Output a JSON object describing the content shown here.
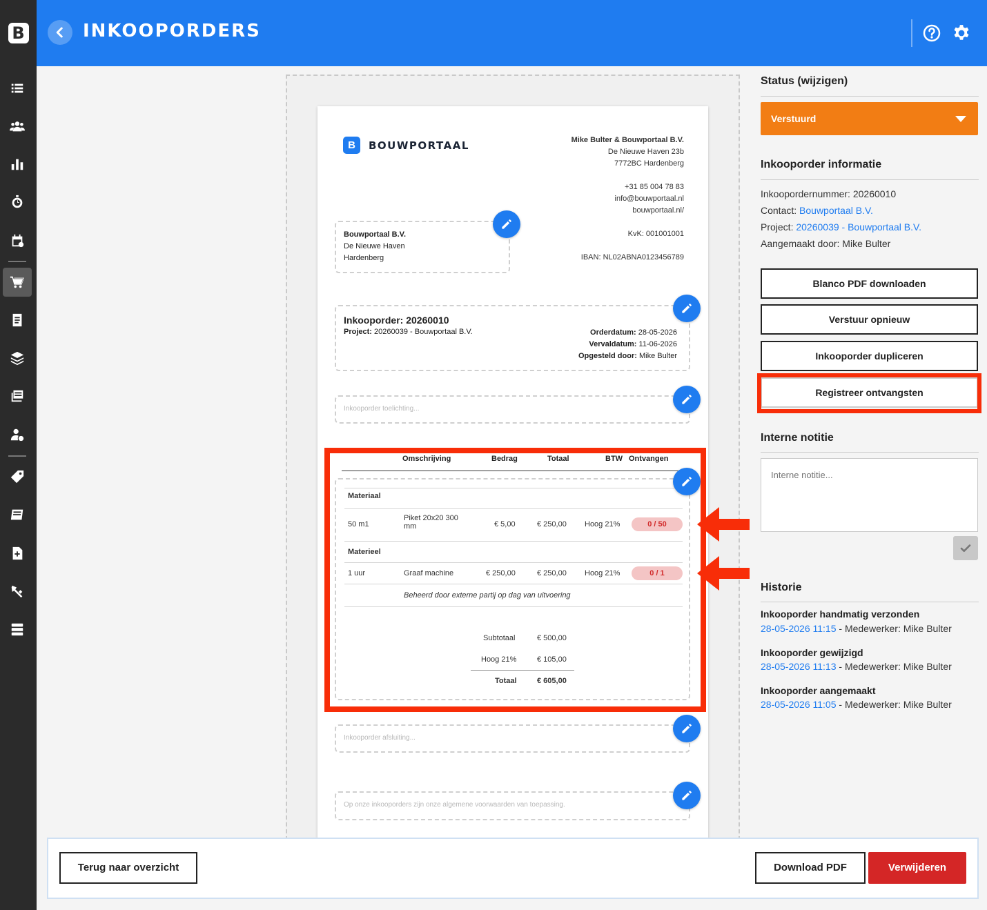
{
  "app": {
    "logo_letter": "B",
    "title": "INKOOPORDERS"
  },
  "sidebar": {
    "items": [
      {
        "icon": "list-icon"
      },
      {
        "icon": "users-icon"
      },
      {
        "icon": "chart-icon"
      },
      {
        "icon": "stopwatch-icon"
      },
      {
        "icon": "calendar-icon"
      },
      {
        "icon": "cart-icon",
        "active": true
      },
      {
        "icon": "document-icon"
      },
      {
        "icon": "layers-icon"
      },
      {
        "icon": "stack-icon"
      },
      {
        "icon": "user-settings-icon"
      },
      {
        "icon": "tag-icon"
      },
      {
        "icon": "book-icon"
      },
      {
        "icon": "file-plus-icon"
      },
      {
        "icon": "tools-icon"
      },
      {
        "icon": "server-icon"
      }
    ]
  },
  "document": {
    "brand_letter": "B",
    "brand_name": "BOUWPORTAAL",
    "company": {
      "name": "Mike Bulter & Bouwportaal B.V.",
      "street": "De Nieuwe Haven 23b",
      "city": "7772BC Hardenberg",
      "phone": "+31 85 004 78 83",
      "email": "info@bouwportaal.nl",
      "website": "bouwportaal.nl/",
      "kvk": "KvK: 001001001",
      "iban": "IBAN: NL02ABNA0123456789"
    },
    "recipient": {
      "name": "Bouwportaal B.V.",
      "street": "De Nieuwe Haven",
      "city": "Hardenberg"
    },
    "order": {
      "title": "Inkooporder: 20260010",
      "project_label": "Project:",
      "project_value": "20260039 - Bouwportaal B.V.",
      "orderdatum_label": "Orderdatum:",
      "orderdatum_value": "28-05-2026",
      "vervaldatum_label": "Vervaldatum:",
      "vervaldatum_value": "11-06-2026",
      "opgesteld_label": "Opgesteld door:",
      "opgesteld_value": "Mike Bulter"
    },
    "toelichting_placeholder": "Inkooporder toelichting...",
    "table_headers": {
      "omschrijving": "Omschrijving",
      "bedrag": "Bedrag",
      "totaal": "Totaal",
      "btw": "BTW",
      "ontvangen": "Ontvangen"
    },
    "groups": [
      {
        "name": "Materiaal",
        "row": {
          "qty": "50 m1",
          "desc_line1": "Piket 20x20 300",
          "desc_line2": "mm",
          "bedrag": "€ 5,00",
          "totaal": "€ 250,00",
          "btw": "Hoog 21%",
          "ontvangen": "0 / 50"
        }
      },
      {
        "name": "Materieel",
        "row": {
          "qty": "1 uur",
          "desc": "Graaf machine",
          "bedrag": "€ 250,00",
          "totaal": "€ 250,00",
          "btw": "Hoog 21%",
          "ontvangen": "0 / 1"
        },
        "note": "Beheerd door externe partij op dag van uitvoering"
      }
    ],
    "totals": {
      "subtotaal_label": "Subtotaal",
      "subtotaal_value": "€ 500,00",
      "btw_label": "Hoog 21%",
      "btw_value": "€ 105,00",
      "totaal_label": "Totaal",
      "totaal_value": "€ 605,00"
    },
    "afsluiting_placeholder": "Inkooporder afsluiting...",
    "voorwaarden_placeholder": "Op onze inkooporders zijn onze algemene voorwaarden van toepassing."
  },
  "right": {
    "status_title": "Status (wijzigen)",
    "status_value": "Verstuurd",
    "info_title": "Inkooporder informatie",
    "info": {
      "nummer": "Inkoopordernummer: 20260010",
      "contact_label": "Contact: ",
      "contact_value": "Bouwportaal B.V.",
      "project_label": "Project: ",
      "project_value": "20260039 - Bouwportaal B.V.",
      "aangemaakt": "Aangemaakt door: Mike Bulter"
    },
    "buttons": {
      "blanco": "Blanco PDF downloaden",
      "verstuur": "Verstuur opnieuw",
      "dupliceren": "Inkooporder dupliceren",
      "registreer": "Registreer ontvangsten"
    },
    "notes_title": "Interne notitie",
    "notes_placeholder": "Interne notitie...",
    "history_title": "Historie",
    "history": [
      {
        "title": "Inkooporder handmatig verzonden",
        "date": "28-05-2026 11:15",
        "meta": " - Medewerker: Mike Bulter"
      },
      {
        "title": "Inkooporder gewijzigd",
        "date": "28-05-2026 11:13",
        "meta": " - Medewerker: Mike Bulter"
      },
      {
        "title": "Inkooporder aangemaakt",
        "date": "28-05-2026 11:05",
        "meta": " - Medewerker: Mike Bulter"
      }
    ]
  },
  "footer": {
    "back": "Terug naar overzicht",
    "download": "Download PDF",
    "delete": "Verwijderen"
  },
  "colors": {
    "primary": "#1f7cf0",
    "status": "#f27d14",
    "danger": "#d42626",
    "annotation": "#f82d08",
    "sidebar": "#2b2b2b"
  }
}
